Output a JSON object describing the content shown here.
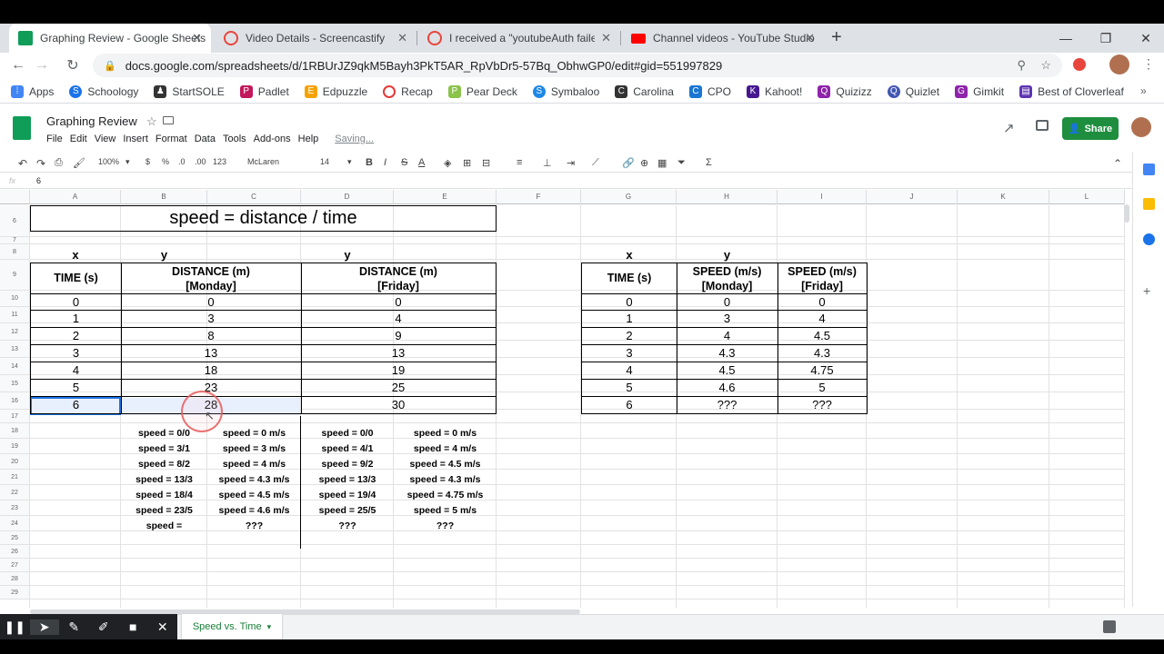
{
  "browser": {
    "tabs": [
      {
        "title": "Graphing Review - Google Sheets",
        "active": true
      },
      {
        "title": "Video Details - Screencastify",
        "active": false
      },
      {
        "title": "I received a \"youtubeAuth failed\"",
        "active": false
      },
      {
        "title": "Channel videos - YouTube Studio",
        "active": false
      }
    ],
    "url": "docs.google.com/spreadsheets/d/1RBUrJZ9qkM5Bayh3PkT5AR_RpVbDr5-57Bq_ObhwGP0/edit#gid=551997829",
    "bookmarks": [
      "Apps",
      "Schoology",
      "StartSOLE",
      "Padlet",
      "Edpuzzle",
      "Recap",
      "Pear Deck",
      "Symbaloo",
      "Carolina",
      "CPO",
      "Kahoot!",
      "Quizizz",
      "Quizlet",
      "Gimkit",
      "Best of Cloverleaf"
    ]
  },
  "doc": {
    "title": "Graphing Review",
    "menus": [
      "File",
      "Edit",
      "View",
      "Insert",
      "Format",
      "Data",
      "Tools",
      "Add-ons",
      "Help"
    ],
    "status": "Saving...",
    "share_label": "Share"
  },
  "toolbar": {
    "zoom": "100%",
    "currency": "$",
    "percent": "%",
    "dec1": ".0",
    "dec2": ".00",
    "format": "123",
    "font": "McLaren",
    "size": "14"
  },
  "formula": {
    "fx": "fx",
    "value": "6"
  },
  "columns": [
    "A",
    "B",
    "C",
    "D",
    "E",
    "F",
    "G",
    "H",
    "I",
    "J",
    "K",
    "L"
  ],
  "rows": [
    "6",
    "7",
    "8",
    "9",
    "10",
    "11",
    "12",
    "13",
    "14",
    "15",
    "16",
    "17",
    "18",
    "19",
    "20",
    "21",
    "22",
    "23",
    "24",
    "25",
    "26",
    "27",
    "28",
    "29"
  ],
  "sheet": {
    "header_title": "speed = distance / time",
    "left_xy": {
      "x": "x",
      "y1": "y",
      "y2": "y"
    },
    "left_headers": {
      "time": "TIME (s)",
      "dist_mon_1": "DISTANCE (m)",
      "dist_mon_2": "[Monday]",
      "dist_fri_1": "DISTANCE (m)",
      "dist_fri_2": "[Friday]"
    },
    "left_rows": [
      {
        "t": "0",
        "mon": "0",
        "fri": "0"
      },
      {
        "t": "1",
        "mon": "3",
        "fri": "4"
      },
      {
        "t": "2",
        "mon": "8",
        "fri": "9"
      },
      {
        "t": "3",
        "mon": "13",
        "fri": "13"
      },
      {
        "t": "4",
        "mon": "18",
        "fri": "19"
      },
      {
        "t": "5",
        "mon": "23",
        "fri": "25"
      },
      {
        "t": "6",
        "mon": "28",
        "fri": "30"
      }
    ],
    "right_xy": {
      "x": "x",
      "y": "y"
    },
    "right_headers": {
      "time": "TIME (s)",
      "sp_mon_1": "SPEED (m/s)",
      "sp_mon_2": "[Monday]",
      "sp_fri_1": "SPEED (m/s)",
      "sp_fri_2": "[Friday]"
    },
    "right_rows": [
      {
        "t": "0",
        "mon": "0",
        "fri": "0"
      },
      {
        "t": "1",
        "mon": "3",
        "fri": "4"
      },
      {
        "t": "2",
        "mon": "4",
        "fri": "4.5"
      },
      {
        "t": "3",
        "mon": "4.3",
        "fri": "4.3"
      },
      {
        "t": "4",
        "mon": "4.5",
        "fri": "4.75"
      },
      {
        "t": "5",
        "mon": "4.6",
        "fri": "5"
      },
      {
        "t": "6",
        "mon": "???",
        "fri": "???"
      }
    ],
    "calc_mon": [
      {
        "f": "speed = 0/0",
        "r": "speed = 0 m/s"
      },
      {
        "f": "speed = 3/1",
        "r": "speed = 3 m/s"
      },
      {
        "f": "speed = 8/2",
        "r": "speed = 4 m/s"
      },
      {
        "f": "speed = 13/3",
        "r": "speed = 4.3 m/s"
      },
      {
        "f": "speed = 18/4",
        "r": "speed = 4.5 m/s"
      },
      {
        "f": "speed = 23/5",
        "r": "speed = 4.6 m/s"
      },
      {
        "f": "speed =",
        "r": "???"
      }
    ],
    "calc_fri": [
      {
        "f": "speed = 0/0",
        "r": "speed = 0 m/s"
      },
      {
        "f": "speed = 4/1",
        "r": "speed = 4 m/s"
      },
      {
        "f": "speed = 9/2",
        "r": "speed = 4.5 m/s"
      },
      {
        "f": "speed = 13/3",
        "r": "speed = 4.3 m/s"
      },
      {
        "f": "speed = 19/4",
        "r": "speed = 4.75 m/s"
      },
      {
        "f": "speed = 25/5",
        "r": "speed = 5 m/s"
      },
      {
        "f": "???",
        "r": "???"
      }
    ]
  },
  "sheet_tab": "Speed vs. Time",
  "colors": {
    "share": "#1e8e3e",
    "selection": "#e8f0fe",
    "selection_border": "#1a73e8"
  }
}
